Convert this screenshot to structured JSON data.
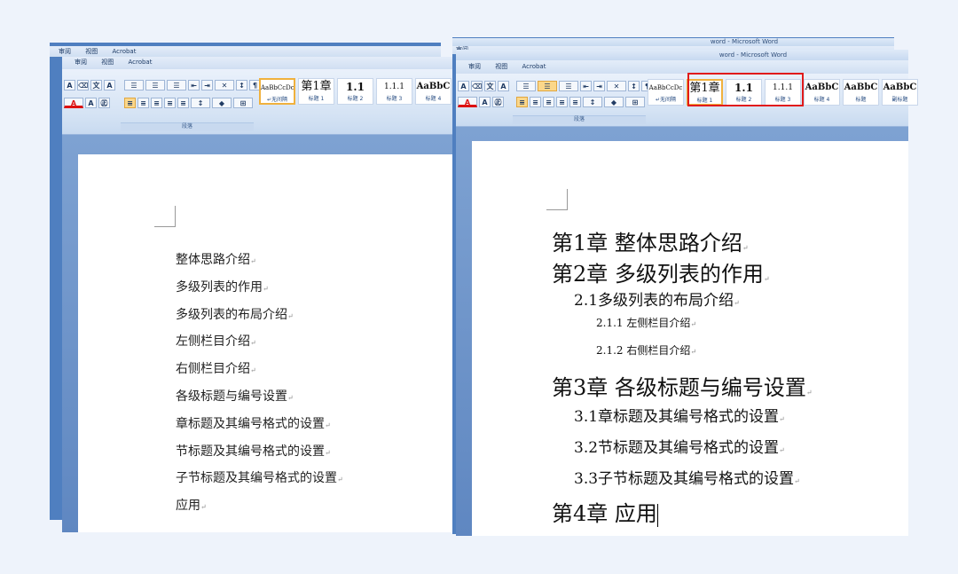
{
  "left_window": {
    "back_menu": [
      "审阅",
      "视图",
      "Acrobat"
    ],
    "menu": [
      "审阅",
      "视图",
      "Acrobat"
    ],
    "paragraph_group_label": "段落",
    "styles": [
      {
        "preview": "AaBbCcDc",
        "label": "↵无间隔"
      },
      {
        "preview": "第1章",
        "label": "标题 1"
      },
      {
        "preview": "1.1",
        "label": "标题 2"
      },
      {
        "preview": "1.1.1",
        "label": "标题 3"
      },
      {
        "preview": "AaBbC",
        "label": "标题 4"
      }
    ],
    "lines": [
      "整体思路介绍",
      "多级列表的作用",
      "多级列表的布局介绍",
      "左侧栏目介绍",
      "右侧栏目介绍",
      "各级标题与编号设置",
      "章标题及其编号格式的设置",
      "节标题及其编号格式的设置",
      "子节标题及其编号格式的设置",
      "应用"
    ]
  },
  "right_window": {
    "title_back": "word - Microsoft Word",
    "title": "word - Microsoft Word",
    "back_menu": [
      "审阅"
    ],
    "menu": [
      "审阅",
      "视图",
      "Acrobat"
    ],
    "paragraph_group_label": "段落",
    "styles": [
      {
        "preview": "AaBbCcDc",
        "label": "↵无间隔"
      },
      {
        "preview": "第1章",
        "label": "标题 1"
      },
      {
        "preview": "1.1",
        "label": "标题 2"
      },
      {
        "preview": "1.1.1",
        "label": "标题 3"
      },
      {
        "preview": "AaBbC",
        "label": "标题 4"
      },
      {
        "preview": "AaBbC",
        "label": "标题"
      },
      {
        "preview": "AaBbC",
        "label": "副标题"
      }
    ],
    "lines": [
      {
        "text": "第1章 整体思路介绍",
        "level": 1
      },
      {
        "text": "第2章 多级列表的作用",
        "level": 1
      },
      {
        "text": "2.1多级列表的布局介绍",
        "level": 2
      },
      {
        "text": "2.1.1 左侧栏目介绍",
        "level": 3
      },
      {
        "text": "2.1.2 右侧栏目介绍",
        "level": 3
      },
      {
        "text": "第3章 各级标题与编号设置",
        "level": 1
      },
      {
        "text": "3.1章标题及其编号格式的设置",
        "level": 2
      },
      {
        "text": "3.2节标题及其编号格式的设置",
        "level": 2
      },
      {
        "text": "3.3子节标题及其编号格式的设置",
        "level": 2
      },
      {
        "text": "第4章 应用",
        "level": 1
      }
    ]
  },
  "colors": {
    "highlight": "#e11b1b",
    "active_style": "#f0b13d",
    "ribbon_blue": "#d5e3f4"
  },
  "pilcrow": "↵"
}
